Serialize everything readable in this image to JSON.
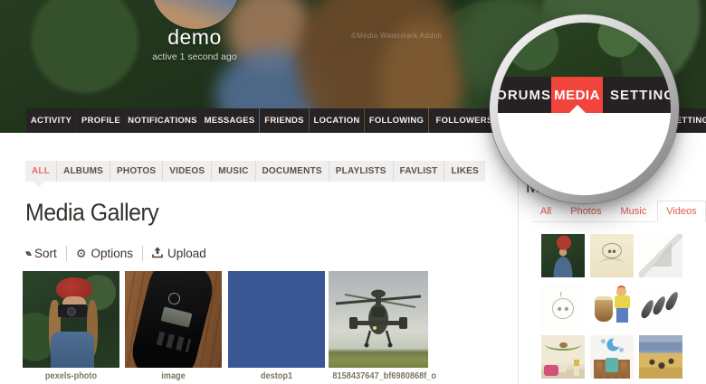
{
  "profile": {
    "username": "demo",
    "status": "active 1 second ago"
  },
  "cover": {
    "watermark": "©Media Watermark Addon"
  },
  "nav": {
    "items": [
      "ACTIVITY",
      "PROFILE",
      "NOTIFICATIONS",
      "MESSAGES",
      "FRIENDS",
      "LOCATION",
      "FOLLOWING",
      "FOLLOWERS",
      "FORUMS",
      "MEDIA",
      "SETTINGS"
    ],
    "active": "MEDIA"
  },
  "subnav": {
    "items": [
      "ALL",
      "ALBUMS",
      "PHOTOS",
      "VIDEOS",
      "MUSIC",
      "DOCUMENTS",
      "PLAYLISTS",
      "FAVLIST",
      "LIKES"
    ],
    "active": "ALL"
  },
  "page": {
    "title": "Media Gallery"
  },
  "toolbar": {
    "sort": "Sort",
    "options": "Options",
    "upload": "Upload",
    "sort_icon": "sort-arrows-icon",
    "options_icon": "gear-icon",
    "upload_icon": "upload-tray-icon"
  },
  "gallery": {
    "items": [
      {
        "label": "pexels-photo",
        "kind": "photo-woman-red-beanie-camera"
      },
      {
        "label": "image",
        "kind": "photo-remote-on-wood"
      },
      {
        "label": "destop1",
        "kind": "solid-blue-image"
      },
      {
        "label": "8158437647_bf6980868f_o",
        "kind": "photo-apache-helicopter"
      }
    ]
  },
  "sidebar": {
    "title": "MEDIA",
    "tabs": [
      "All",
      "Photos",
      "Music",
      "Videos"
    ],
    "active_tab": "Videos",
    "thumbs": [
      "woman-red-beanie",
      "girl-sketch",
      "paper-plane-sketch",
      "baby-sketch",
      "boy-with-djembe-drum",
      "feathers-sketch",
      "nursery-room",
      "crib-with-moon-decal",
      "savanna-field"
    ]
  },
  "colors": {
    "accent_red": "#f0443c",
    "subnav_active_red": "#ed6a5e",
    "sidebar_link_red": "#e05a50",
    "navbar_bg": "#262122",
    "subnav_bg": "#f0efee",
    "destop1_blue": "#3a5795"
  }
}
